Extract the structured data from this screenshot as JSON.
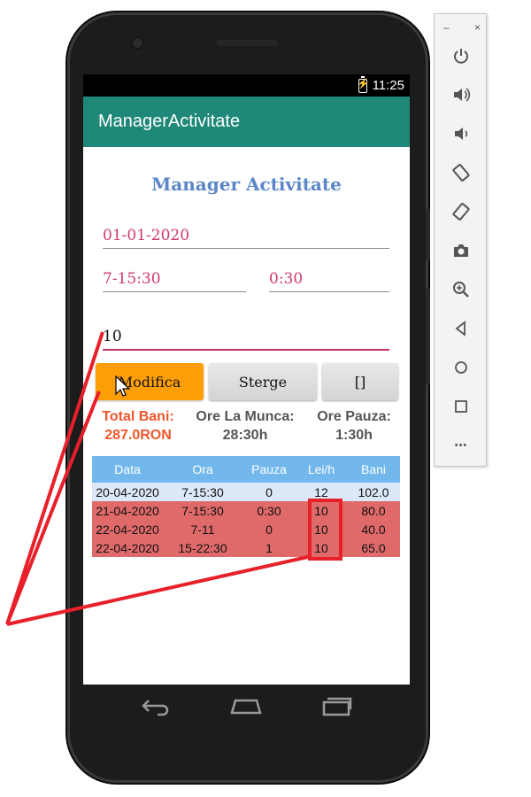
{
  "status_bar": {
    "time": "11:25"
  },
  "app_bar": {
    "title": "ManagerActivitate"
  },
  "screen": {
    "heading": "Manager Activitate",
    "date_field": "01-01-2020",
    "hours_field": "7-15:30",
    "pause_field": "0:30",
    "rate_field": "10"
  },
  "buttons": {
    "modify": "Modifica",
    "delete": "Sterge",
    "list": "[]"
  },
  "summary": {
    "total_label": "Total Bani:",
    "total_value": "287.0RON",
    "hours_label": "Ore La Munca:",
    "hours_value": "28:30h",
    "pause_label": "Ore Pauza:",
    "pause_value": "1:30h"
  },
  "colors": {
    "app_bar": "#1f8878",
    "heading": "#5b86c8",
    "field_text": "#d03a6b",
    "modify_button": "#ff9f08",
    "total_text": "#f0562a",
    "summary_text": "#555555",
    "table_header": "#72b8ec",
    "row_normal": "#dce8f8",
    "row_selected": "#e06a6a",
    "annotation": "#e8202a"
  },
  "table": {
    "headers": [
      "Data",
      "Ora",
      "Pauza",
      "Lei/h",
      "Bani"
    ],
    "rows": [
      {
        "data": "20-04-2020",
        "ora": "7-15:30",
        "pauza": "0",
        "lei": "12",
        "bani": "102.0",
        "style": "light"
      },
      {
        "data": "21-04-2020",
        "ora": "7-15:30",
        "pauza": "0:30",
        "lei": "10",
        "bani": "80.0",
        "style": "red"
      },
      {
        "data": "22-04-2020",
        "ora": "7-11",
        "pauza": "0",
        "lei": "10",
        "bani": "40.0",
        "style": "red"
      },
      {
        "data": "22-04-2020",
        "ora": "15-22:30",
        "pauza": "1",
        "lei": "10",
        "bani": "65.0",
        "style": "red"
      }
    ]
  },
  "nav_bar": {
    "icons": [
      "back-icon",
      "home-icon",
      "recents-icon"
    ]
  },
  "emulator_toolbar": {
    "window_controls": [
      "minimize-icon",
      "close-icon"
    ],
    "minimize": "–",
    "close": "×",
    "more": "•••",
    "items": [
      "power-icon",
      "volume-up-icon",
      "volume-down-icon",
      "rotate-left-icon",
      "rotate-right-icon",
      "camera-icon",
      "zoom-icon",
      "back-icon",
      "home-icon",
      "overview-icon",
      "more-icon"
    ]
  }
}
